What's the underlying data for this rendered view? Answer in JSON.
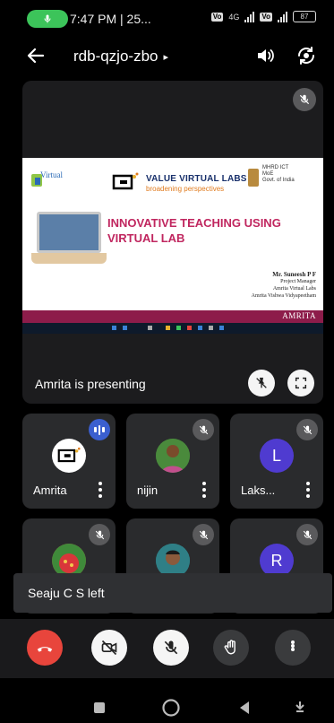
{
  "status_bar": {
    "time": "7:47 PM | 25...",
    "net_tag_1": "Vo",
    "net_gen": "4G",
    "net_tag_2": "Vo",
    "battery": "87"
  },
  "header": {
    "meeting_code": "rdb-qzjo-zbo",
    "caret": "▸"
  },
  "slide": {
    "vl_logo_text": "Virtual",
    "vvl_title": "VALUE VIRTUAL LABS",
    "vvl_sub": "broadening perspectives",
    "mhrd_line1": "MHRD ICT",
    "mhrd_line2": "MoE",
    "mhrd_line3": "Govt. of India",
    "title": "INNOVATIVE TEACHING USING VIRTUAL LAB",
    "presenter_name": "Mr. Suneesh P F",
    "presenter_role": "Project Manager",
    "presenter_org1": "Amrita Virtual Labs",
    "presenter_org2": "Amrita Vishwa Vidyapeetham",
    "band_text": "AMRITA"
  },
  "presenting_label": "Amrita is presenting",
  "participants": [
    {
      "name": "Amrita",
      "state": "speaking"
    },
    {
      "name": "nijin",
      "state": "muted"
    },
    {
      "name": "Laks...",
      "state": "muted",
      "initial": "L",
      "color": "#4f3bd0"
    },
    {
      "name": "",
      "state": "muted"
    },
    {
      "name": "",
      "state": "muted"
    },
    {
      "name": "",
      "state": "muted",
      "initial": "R",
      "color": "#4f3bd0"
    }
  ],
  "toast": {
    "text": "Seaju C S left"
  },
  "colors": {
    "end_call": "#e8453c",
    "control_bg": "#f5f5f5",
    "speaking": "#3b5fcf",
    "call_pill": "#3cc45a"
  }
}
